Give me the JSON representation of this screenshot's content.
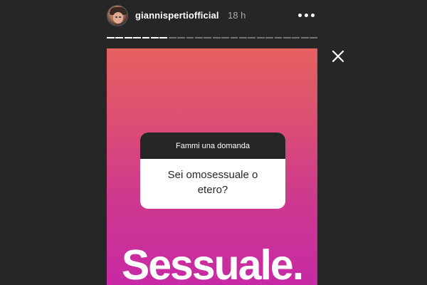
{
  "header": {
    "username": "giannispertiofficial",
    "timestamp": "18 h"
  },
  "progress": {
    "total_segments": 24,
    "completed_segments": 7
  },
  "icons": {
    "more": "more-options-icon",
    "close": "close-icon",
    "avatar": "profile-avatar"
  },
  "question_sticker": {
    "title": "Fammi una domanda",
    "question": "Sei omosessuale o etero?"
  },
  "story_text": "Sessuale.",
  "colors": {
    "background": "#262626",
    "gradient_top": "#e5605f",
    "gradient_bottom": "#c729a4",
    "sticker_header": "#262626"
  }
}
